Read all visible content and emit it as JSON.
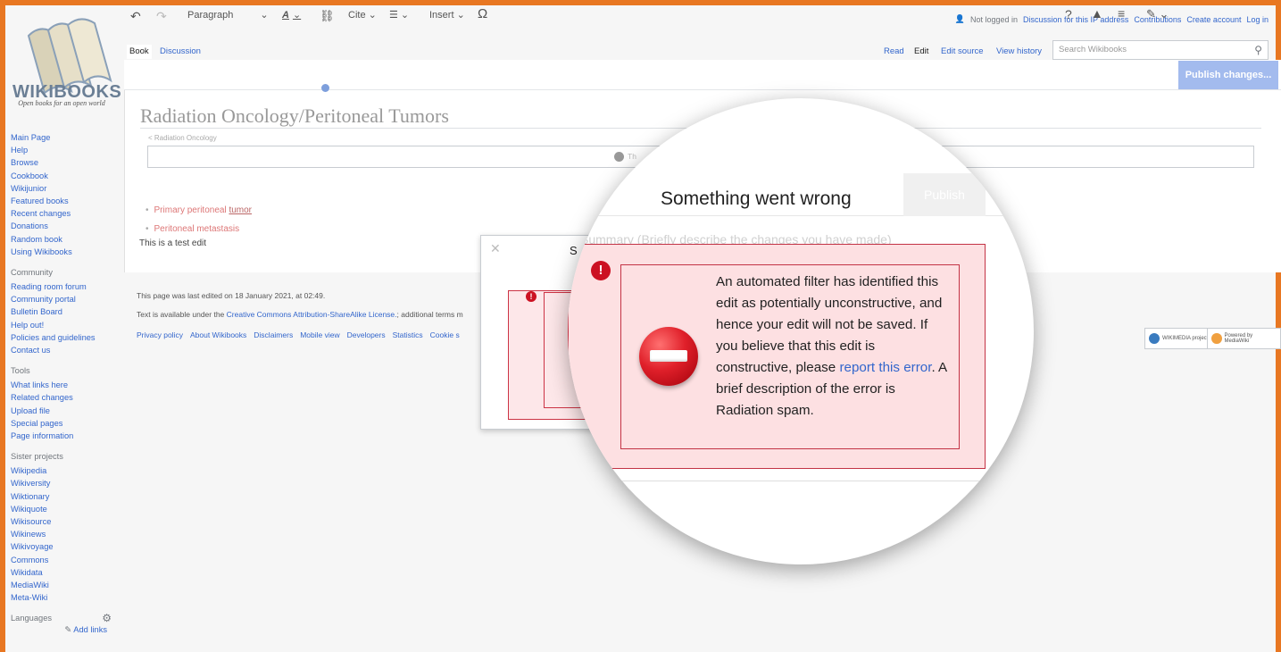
{
  "logo": {
    "title": "WIKIBOOKS",
    "tagline": "Open books for an open world"
  },
  "personal": {
    "not_logged_in": "Not logged in",
    "discussion_ip": "Discussion for this IP address",
    "contributions": "Contributions",
    "create_account": "Create account",
    "log_in": "Log in"
  },
  "tabs": {
    "book": "Book",
    "discussion": "Discussion",
    "read": "Read",
    "edit": "Edit",
    "edit_source": "Edit source",
    "view_history": "View history"
  },
  "search": {
    "placeholder": "Search Wikibooks"
  },
  "sidebar": {
    "nav": [
      "Main Page",
      "Help",
      "Browse",
      "Cookbook",
      "Wikijunior",
      "Featured books",
      "Recent changes",
      "Donations",
      "Random book",
      "Using Wikibooks"
    ],
    "community_head": "Community",
    "community": [
      "Reading room forum",
      "Community portal",
      "Bulletin Board",
      "Help out!",
      "Policies and guidelines",
      "Contact us"
    ],
    "tools_head": "Tools",
    "tools": [
      "What links here",
      "Related changes",
      "Upload file",
      "Special pages",
      "Page information"
    ],
    "sister_head": "Sister projects",
    "sister": [
      "Wikipedia",
      "Wikiversity",
      "Wiktionary",
      "Wikiquote",
      "Wikisource",
      "Wikinews",
      "Wikivoyage",
      "Commons",
      "Wikidata",
      "MediaWiki",
      "Meta-Wiki"
    ],
    "languages_head": "Languages",
    "add_links": "Add links"
  },
  "toolbar": {
    "paragraph": "Paragraph",
    "cite": "Cite",
    "insert": "Insert",
    "publish": "Publish changes..."
  },
  "page": {
    "title": "Radiation Oncology/Peritoneal Tumors",
    "breadcrumb": "< Radiation Oncology",
    "notice_partial": "Th",
    "list": [
      {
        "text": "Primary peritoneal ",
        "underlined": "tumor"
      },
      {
        "text": "Peritoneal metastasis",
        "underlined": ""
      }
    ],
    "test_edit": "This is a test edit"
  },
  "footer": {
    "last_edited": "This page was last edited on 18 January 2021, at 02:49.",
    "license_prefix": "Text is available under the ",
    "license_link": "Creative Commons Attribution-ShareAlike License.",
    "license_suffix": "; additional terms m",
    "links": [
      "Privacy policy",
      "About Wikibooks",
      "Disclaimers",
      "Mobile view",
      "Developers",
      "Statistics",
      "Cookie s"
    ],
    "badge_wikimedia": "WIKIMEDIA project",
    "badge_mediawiki": "Powered by MediaWiki"
  },
  "dialog": {
    "title_partial": "S",
    "title": "Something went wrong",
    "publish_partial": "Publish",
    "summary_placeholder": "Summary (Briefly describe the changes you have made)",
    "error_pre": "An automated filter has identified this edit as potentially unconstructive, and hence your edit will not be saved. If you believe that this edit is constructive, please ",
    "error_link": "report this error",
    "error_post": ". A brief description of the error is Radiation spam."
  },
  "colors": {
    "frame": "#e87722",
    "link": "#3366cc",
    "error_border": "#c33345",
    "error_bg": "#fde0e2",
    "publish_bg": "#a3bbee"
  },
  "icons": [
    "user-icon",
    "search-icon",
    "undo-icon",
    "redo-icon",
    "text-style-icon",
    "link-icon",
    "list-icon",
    "omega-icon",
    "help-icon",
    "notice-icon",
    "menu-icon",
    "pencil-icon",
    "gear-icon",
    "alert-icon",
    "no-entry-icon",
    "close-icon"
  ]
}
